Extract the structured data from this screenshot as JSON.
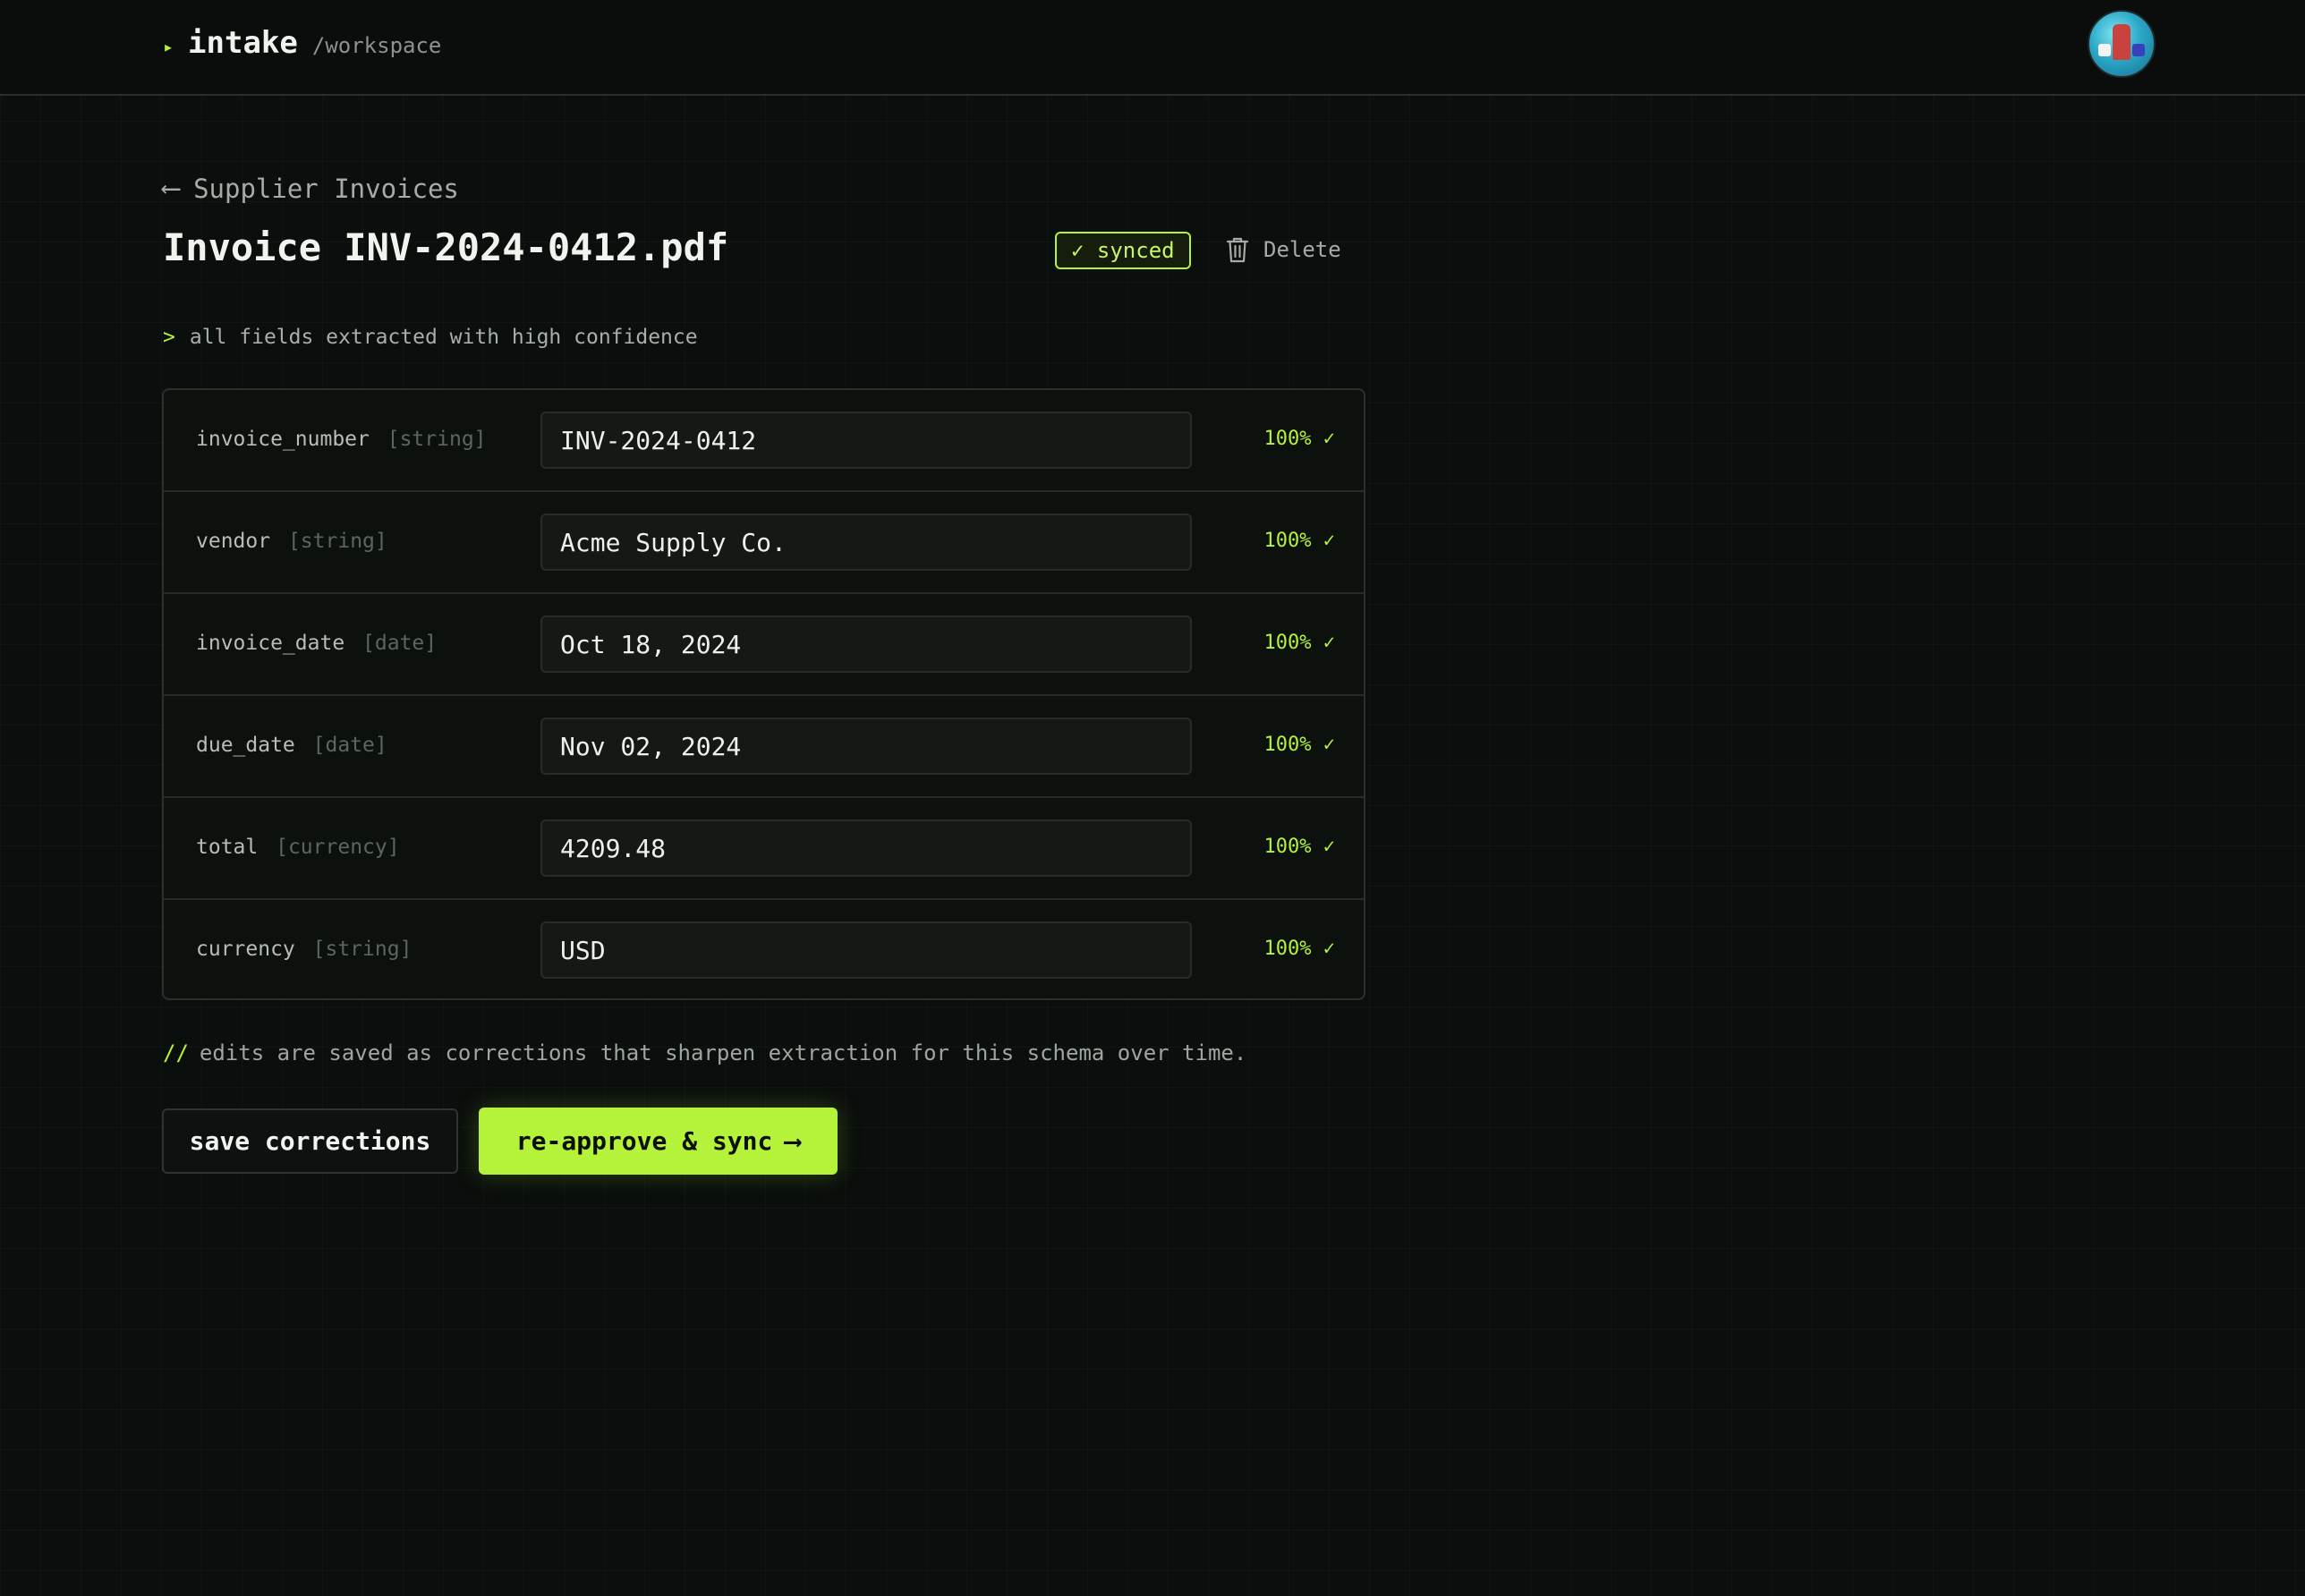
{
  "header": {
    "brand_caret": "▸",
    "brand_name": "intake",
    "brand_path": "/workspace",
    "avatar_icon": "user-avatar"
  },
  "breadcrumb": {
    "arrow": "⟵",
    "label": "Supplier Invoices"
  },
  "page": {
    "title": "Invoice INV-2024-0412.pdf",
    "status_badge": "✓ synced",
    "delete_label": "Delete",
    "delete_icon": "trash-icon"
  },
  "status_line": {
    "prompt": ">",
    "text": "all fields extracted with high confidence"
  },
  "fields": [
    {
      "name": "invoice_number",
      "type": "[string]",
      "value": "INV-2024-0412",
      "confidence": "100% ✓"
    },
    {
      "name": "vendor",
      "type": "[string]",
      "value": "Acme Supply Co.",
      "confidence": "100% ✓"
    },
    {
      "name": "invoice_date",
      "type": "[date]",
      "value": "Oct 18, 2024",
      "confidence": "100% ✓"
    },
    {
      "name": "due_date",
      "type": "[date]",
      "value": "Nov 02, 2024",
      "confidence": "100% ✓"
    },
    {
      "name": "total",
      "type": "[currency]",
      "value": "4209.48",
      "confidence": "100% ✓"
    },
    {
      "name": "currency",
      "type": "[string]",
      "value": "USD",
      "confidence": "100% ✓"
    }
  ],
  "note": {
    "prefix": "//",
    "text": "edits are saved as corrections that sharpen extraction for this schema over time."
  },
  "actions": {
    "save_label": "save corrections",
    "approve_label": "re-approve & sync",
    "approve_arrow": "⟶"
  },
  "colors": {
    "accent": "#b4f33a",
    "background": "#0a0e0c",
    "panel": "#0c110e",
    "text": "#f1f3ee",
    "muted": "#a6aba6"
  }
}
